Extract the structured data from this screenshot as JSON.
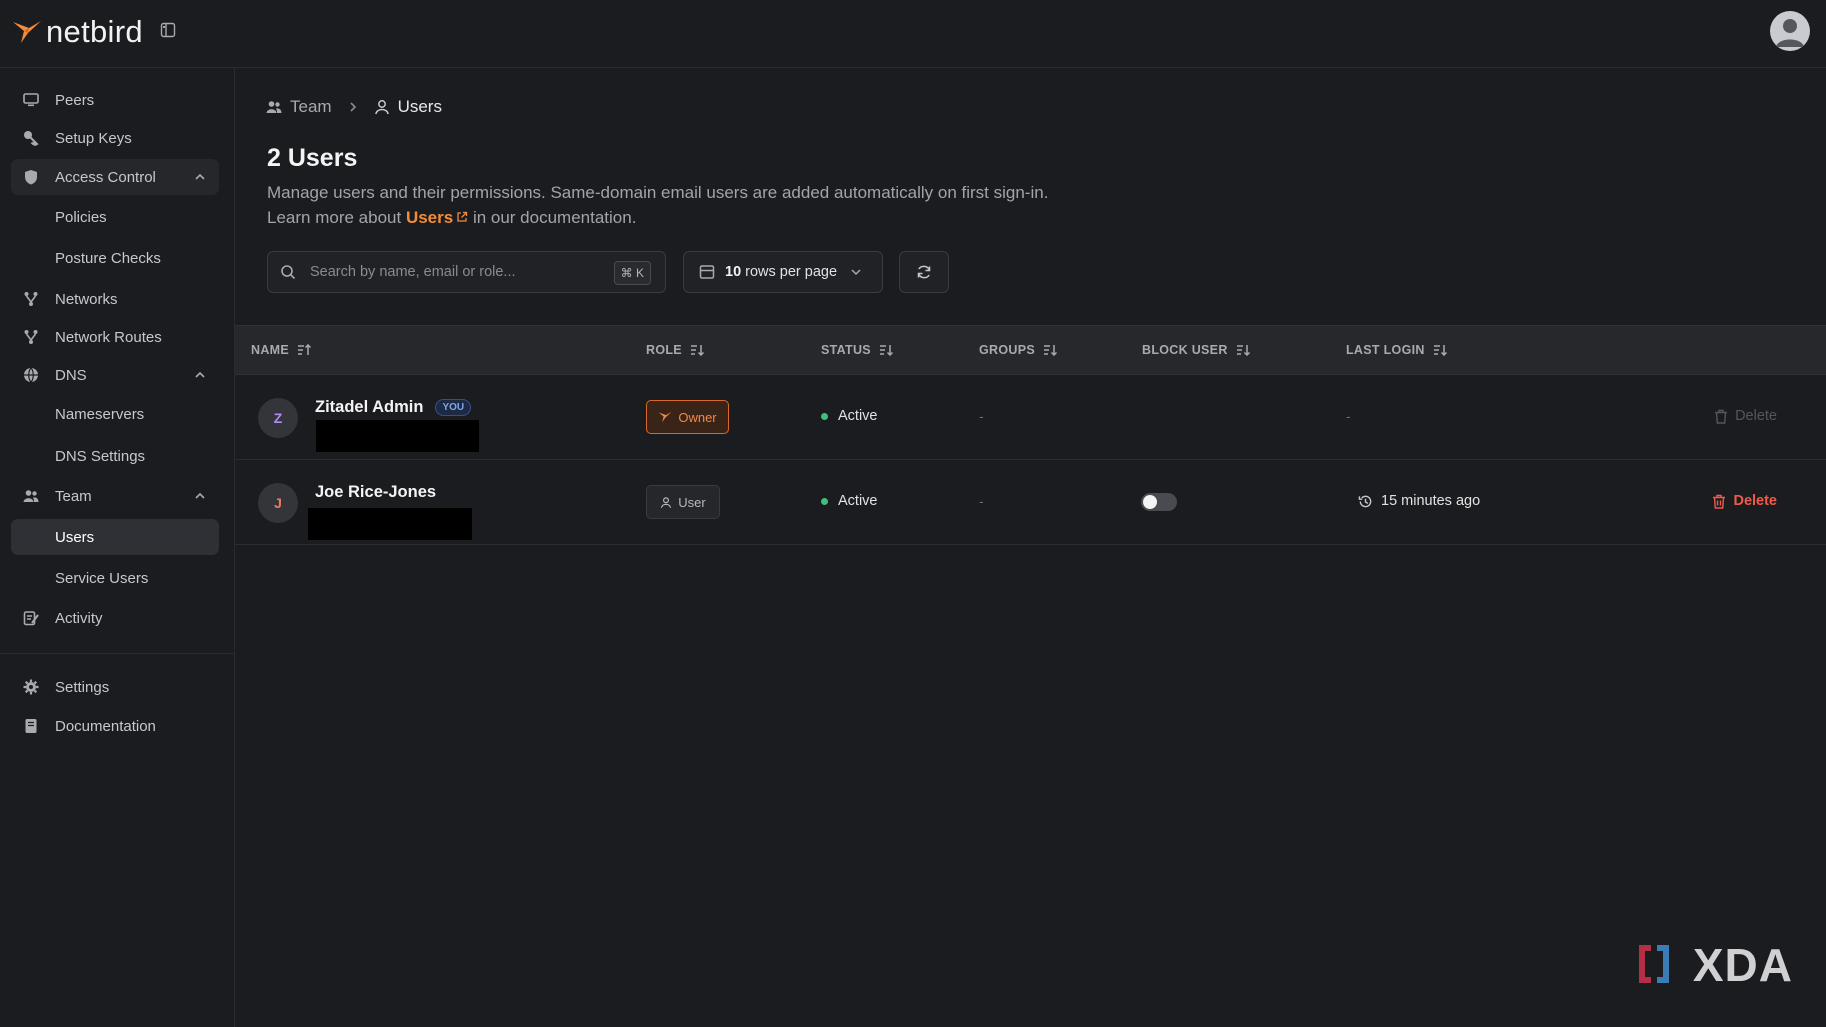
{
  "app": {
    "brand": "netbird",
    "accent_color": "#f28c3b"
  },
  "sidebar": {
    "items": [
      {
        "label": "Peers",
        "icon": "monitor-icon"
      },
      {
        "label": "Setup Keys",
        "icon": "key-icon"
      },
      {
        "label": "Access Control",
        "icon": "shield-icon",
        "expanded": true
      },
      {
        "label": "Policies"
      },
      {
        "label": "Posture Checks"
      },
      {
        "label": "Networks",
        "icon": "network-icon"
      },
      {
        "label": "Network Routes",
        "icon": "route-icon"
      },
      {
        "label": "DNS",
        "icon": "globe-icon",
        "expanded": true
      },
      {
        "label": "Nameservers"
      },
      {
        "label": "DNS Settings"
      },
      {
        "label": "Team",
        "icon": "team-icon",
        "expanded": true
      },
      {
        "label": "Users",
        "active": true
      },
      {
        "label": "Service Users"
      },
      {
        "label": "Activity",
        "icon": "activity-icon"
      },
      {
        "label": "Settings",
        "icon": "gear-icon"
      },
      {
        "label": "Documentation",
        "icon": "book-icon"
      }
    ]
  },
  "breadcrumb": {
    "parent": "Team",
    "current": "Users"
  },
  "page": {
    "title": "2 Users",
    "description_line1": "Manage users and their permissions. Same-domain email users are added automatically on first sign-in.",
    "learn_prefix": "Learn more about",
    "learn_link": "Users",
    "learn_suffix": "in our documentation."
  },
  "toolbar": {
    "search_placeholder": "Search by name, email or role...",
    "search_shortcut": "⌘ K",
    "rows_count": "10",
    "rows_label": "rows per page"
  },
  "table": {
    "columns": [
      "NAME",
      "ROLE",
      "STATUS",
      "GROUPS",
      "BLOCK USER",
      "LAST LOGIN"
    ],
    "rows": [
      {
        "initial": "Z",
        "initial_color": "#b18cf0",
        "name": "Zitadel Admin",
        "badge": "YOU",
        "role": "Owner",
        "status": "Active",
        "groups": "-",
        "block_user": null,
        "last_login": "-",
        "action": "Delete",
        "action_enabled": false
      },
      {
        "initial": "J",
        "initial_color": "#f07a5a",
        "name": "Joe Rice-Jones",
        "role": "User",
        "status": "Active",
        "groups": "-",
        "block_user": false,
        "last_login": "15 minutes ago",
        "action": "Delete",
        "action_enabled": true
      }
    ]
  },
  "watermark": "XDA"
}
